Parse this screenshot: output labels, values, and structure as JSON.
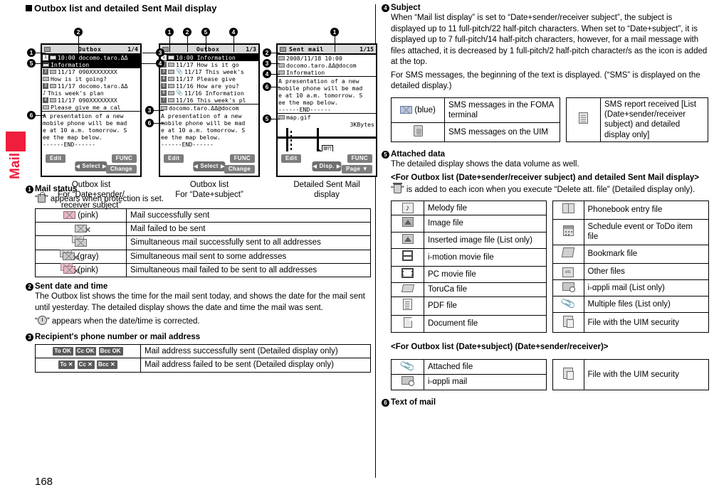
{
  "page": {
    "number": "168",
    "side_tab_label": "Mail",
    "accent_color": "#EE1E3C"
  },
  "section": {
    "title": "Outbox list and detailed Sent Mail display"
  },
  "figures": {
    "phone1": {
      "statusbar": {
        "title": "Outbox",
        "counter": "1/4"
      },
      "rows": [
        {
          "index": "1",
          "line1": "10:00 docomo.taro.ΔΔ",
          "line2": "Information"
        },
        {
          "index": "2",
          "line1": "11/17 090XXXXXXXX",
          "line2": "How is it going?"
        },
        {
          "index": "3",
          "line1": "11/17 docomo.taro.ΔΔ",
          "line2": "This week's plan"
        },
        {
          "index": "4",
          "line1": "11/17 090XXXXXXXX",
          "line2": "Please give me a cal"
        }
      ],
      "body": "A presentation of a new\nmobile phone will be mad\ne at 10 a.m. tomorrow. S\nee the map below.\n------END------",
      "softkeys": {
        "left": "Edit",
        "mid": "Select",
        "right": "FUNC",
        "right2": "Change"
      },
      "caption_line1": "Outbox list",
      "caption_line2": "For “Date+sender/",
      "caption_line3": "receiver subject”"
    },
    "phone2": {
      "statusbar": {
        "title": "Outbox",
        "counter": "1/3"
      },
      "rows": [
        {
          "index": "1",
          "text": "10:00  Information"
        },
        {
          "index": "2",
          "text": "11/17  How is it go"
        },
        {
          "index": "3",
          "text": "11/17 This week's"
        },
        {
          "index": "4",
          "text": "11/17  Please give"
        },
        {
          "index": "5",
          "text": "11/16 How are you?"
        },
        {
          "index": "6",
          "text": "11/16 Information"
        },
        {
          "index": "7",
          "text": "11/16 This week's pl"
        }
      ],
      "address": "docomo.taro.ΔΔ@docom",
      "body": "A presentation of a new\nmobile phone will be mad\ne at 10 a.m. tomorrow. S\nee the map below.\n------END------",
      "softkeys": {
        "left": "Edit",
        "mid": "Select",
        "right": "FUNC",
        "right2": "Change"
      },
      "caption_line1": "Outbox list",
      "caption_line2": "For “Date+subject”",
      "caption_line3": ""
    },
    "phone3": {
      "statusbar": {
        "title": "Sent mail",
        "counter": "1/15"
      },
      "datetime": "2008/11/18 10:00",
      "address": "docomo.taro.ΔΔ@docom",
      "subject": "Information",
      "body": "A presentation of a new\nmobile phone will be mad\ne at 10 a.m. tomorrow. S\nee the map below.\n------END------",
      "attachment_name": "map.gif",
      "attachment_size": "3KBytes",
      "map_label": "銀行",
      "softkeys": {
        "left": "Edit",
        "mid": "Disp.",
        "right": "FUNC",
        "right2": "Page ▼"
      },
      "caption_line1": "Detailed Sent Mail",
      "caption_line2": "display",
      "caption_line3": ""
    },
    "callouts": [
      "1",
      "2",
      "3",
      "4",
      "5",
      "6"
    ]
  },
  "items": {
    "mail_status": {
      "num": "1",
      "title": "Mail status",
      "note_before": "“",
      "note_after": "” appears when protection is set.",
      "rows": [
        {
          "icon": "envelope-pink-icon",
          "icon_label": "(pink)",
          "desc": "Mail successfully sent"
        },
        {
          "icon": "envelope-failed-icon",
          "icon_label": "",
          "desc": "Mail failed to be sent"
        },
        {
          "icon": "envelope-stack-icon",
          "icon_label": "",
          "desc": "Simultaneous mail successfully sent to all addresses"
        },
        {
          "icon": "envelope-stack-gray-icon",
          "icon_label": "(gray)",
          "desc": "Simultaneous mail sent to some addresses"
        },
        {
          "icon": "envelope-stack-pink-failed-icon",
          "icon_label": "(pink)",
          "desc": "Simultaneous mail failed to be sent to all addresses"
        }
      ]
    },
    "sent_date": {
      "num": "2",
      "title": "Sent date and time",
      "para": "The Outbox list shows the time for the mail sent today, and shows the date for the mail sent until yesterday. The detailed display shows the date and time the mail was sent.",
      "note_before": "“",
      "note_after": "” appears when the date/time is corrected."
    },
    "recipient": {
      "num": "3",
      "title": "Recipient's phone number or mail address",
      "rows": [
        {
          "icons": [
            "To OK",
            "Cc OK",
            "Bcc OK"
          ],
          "desc": "Mail address successfully sent (Detailed display only)"
        },
        {
          "icons": [
            "To ✕",
            "Cc ✕",
            "Bcc ✕"
          ],
          "desc": "Mail address failed to be sent (Detailed display only)"
        }
      ]
    },
    "subject": {
      "num": "4",
      "title": "Subject",
      "para1": "When “Mail list display” is set to “Date+sender/receiver subject”, the subject is displayed up to 11 full-pitch/22 half-pitch characters. When set to “Date+subject”, it is displayed up to 7 full-pitch/14 half-pitch characters, however, for a mail message with files attached, it is decreased by 1 full-pitch/2 half-pitch character/s as the icon is added at the top.",
      "para2": "For SMS messages, the beginning of the text is displayed. (“SMS” is displayed on the detailed display.)",
      "table_left": [
        {
          "icon": "envelope-blue-icon",
          "icon_label": "(blue)",
          "desc": "SMS messages in the FOMA terminal"
        },
        {
          "icon": "uim-card-icon",
          "icon_label": "",
          "desc": "SMS messages on the UIM"
        }
      ],
      "table_right": [
        {
          "icon": "sms-report-icon",
          "icon_label": "",
          "desc": "SMS report received [List (Date+sender/receiver subject) and detailed display only]"
        }
      ]
    },
    "attached": {
      "num": "5",
      "title": "Attached data",
      "para": "The detailed display shows the data volume as well.",
      "heading1": "<For Outbox list (Date+sender/receiver subject) and detailed Sent Mail display>",
      "note_before": "“",
      "note_after": "” is added to each icon when you execute “Delete att. file” (Detailed display only).",
      "table_left": [
        {
          "icon": "melody-icon",
          "desc": "Melody file"
        },
        {
          "icon": "image-file-icon",
          "desc": "Image file"
        },
        {
          "icon": "inserted-image-icon",
          "desc": "Inserted image file (List only)"
        },
        {
          "icon": "imotion-movie-icon",
          "desc": "i-motion movie file"
        },
        {
          "icon": "pc-movie-icon",
          "desc": "PC movie file"
        },
        {
          "icon": "toruca-icon",
          "desc": "ToruCa file"
        },
        {
          "icon": "pdf-icon",
          "desc": "PDF file"
        },
        {
          "icon": "document-icon",
          "desc": "Document file"
        }
      ],
      "table_right": [
        {
          "icon": "phonebook-icon",
          "desc": "Phonebook entry file"
        },
        {
          "icon": "schedule-icon",
          "desc": "Schedule event or ToDo item file"
        },
        {
          "icon": "bookmark-icon",
          "desc": "Bookmark file"
        },
        {
          "icon": "other-files-icon",
          "desc": "Other files"
        },
        {
          "icon": "iappli-mail-icon",
          "desc": "i-αppli mail (List only)"
        },
        {
          "icon": "multiple-files-icon",
          "desc": "Multiple files (List only)"
        },
        {
          "icon": "uim-security-icon",
          "desc": "File with the UIM security"
        }
      ],
      "heading2": "<For Outbox list (Date+subject) (Date+sender/receiver)>",
      "table2_left": [
        {
          "icon": "paperclip-icon",
          "desc": "Attached file"
        },
        {
          "icon": "iappli-mail-icon",
          "desc": "i-αppli mail"
        }
      ],
      "table2_right": [
        {
          "icon": "uim-security-icon",
          "desc": "File with the UIM security"
        }
      ]
    },
    "text_of_mail": {
      "num": "6",
      "title": "Text of mail"
    }
  }
}
